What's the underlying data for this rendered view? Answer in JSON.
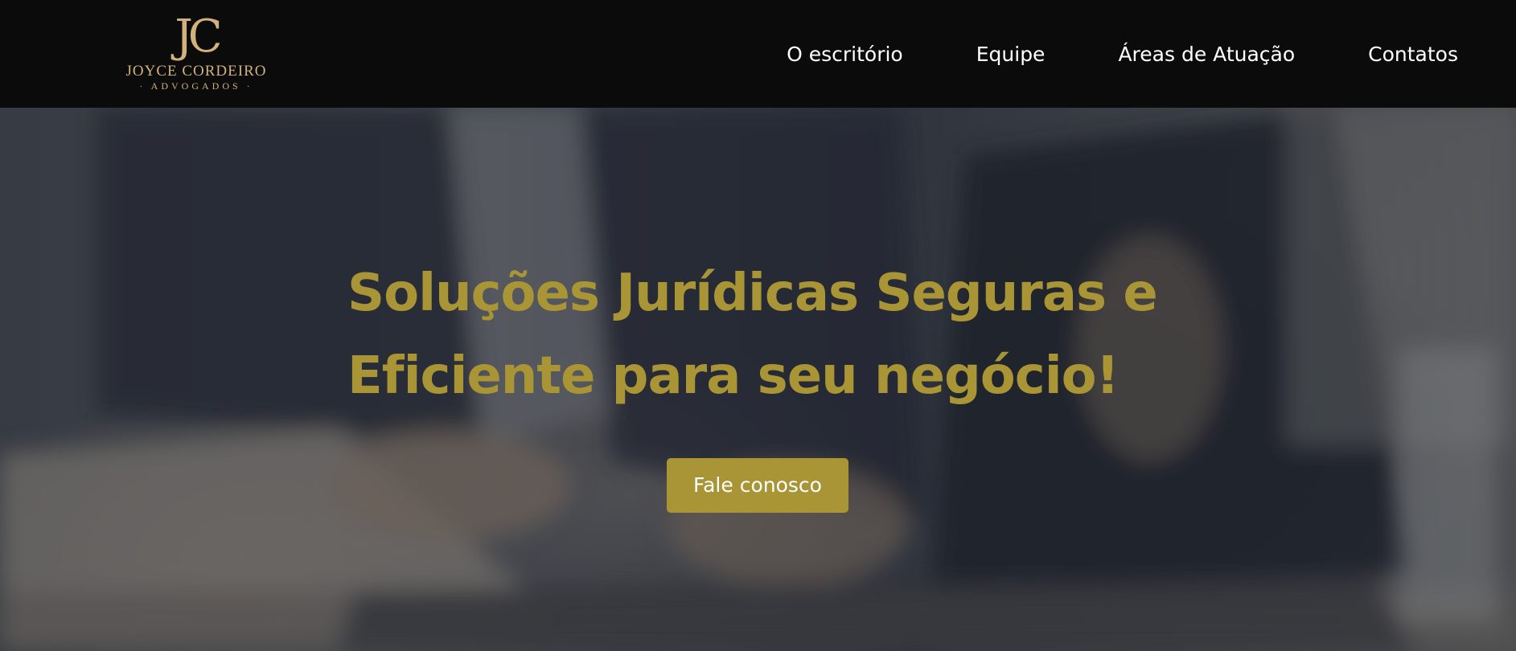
{
  "logo": {
    "monogram": "JC",
    "name": "JOYCE CORDEIRO",
    "subtitle": "· ADVOGADOS ·"
  },
  "nav": {
    "items": [
      {
        "label": "O escritório"
      },
      {
        "label": "Equipe"
      },
      {
        "label": "Áreas de Atuação"
      },
      {
        "label": "Contatos"
      }
    ]
  },
  "hero": {
    "title_line1": "Soluções Jurídicas Seguras e",
    "title_line2": "Eficiente para seu negócio!",
    "cta_label": "Fale conosco"
  },
  "colors": {
    "header_bg": "#0b0b0b",
    "logo_gold": "#d2b27c",
    "accent_gold": "#a99535",
    "nav_text": "#ffffff"
  }
}
